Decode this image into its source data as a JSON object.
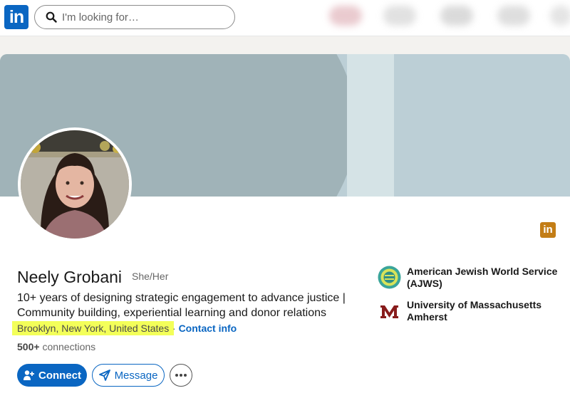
{
  "brand": {
    "logo_text": "in"
  },
  "search": {
    "placeholder": "I'm looking for…"
  },
  "nav_colors": [
    "#d9a0a8",
    "#c9c9c9",
    "#bdbdbd",
    "#c4c4c4",
    "#cfcfcf"
  ],
  "colors": {
    "accent": "#0a66c2",
    "highlight": "#f3ff59",
    "badge": "#c37d16"
  },
  "profile": {
    "name": "Neely Grobani",
    "pronouns": "She/Her",
    "headline": "10+ years of designing strategic engagement to advance justice | Community building, experiential learning and donor relations",
    "location": "Brooklyn, New York, United States",
    "contact_sep": "·",
    "contact_label": "Contact info",
    "connections_count": "500+",
    "connections_label": "connections"
  },
  "actions": {
    "connect_label": "Connect",
    "message_label": "Message"
  },
  "badge": {
    "text": "in"
  },
  "organizations": [
    {
      "name": "American Jewish World Service (AJWS)",
      "icon": "ajws-logo-icon"
    },
    {
      "name": "University of Massachusetts Amherst",
      "icon": "umass-logo-icon"
    }
  ]
}
